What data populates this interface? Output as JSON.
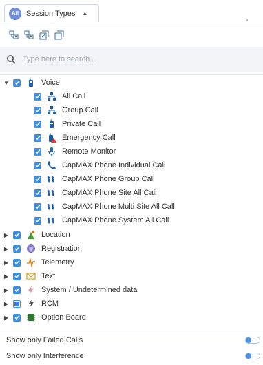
{
  "header": {
    "badge": "All",
    "title": "Session Types"
  },
  "search": {
    "placeholder": "Type here to search..."
  },
  "tree": {
    "groups": [
      {
        "label": "Voice",
        "children": [
          {
            "label": "All Call"
          },
          {
            "label": "Group Call"
          },
          {
            "label": "Private Call"
          },
          {
            "label": "Emergency Call"
          },
          {
            "label": "Remote Monitor"
          },
          {
            "label": "CapMAX Phone Individual Call"
          },
          {
            "label": "CapMAX Phone Group Call"
          },
          {
            "label": "CapMAX Phone Site All Call"
          },
          {
            "label": "CapMAX Phone Multi Site All Call"
          },
          {
            "label": "CapMAX Phone System All Call"
          }
        ]
      },
      {
        "label": "Location"
      },
      {
        "label": "Registration"
      },
      {
        "label": "Telemetry"
      },
      {
        "label": "Text"
      },
      {
        "label": "System / Undetermined data"
      },
      {
        "label": "RCM"
      },
      {
        "label": "Option Board"
      }
    ]
  },
  "options": {
    "failed_calls": {
      "label": "Show only Failed Calls",
      "enabled": false
    },
    "interference": {
      "label": "Show only Interference",
      "enabled": false
    }
  },
  "colors": {
    "accent": "#3d8fe0",
    "badge": "#6f8fd6",
    "search_bg": "#f2f4f7"
  }
}
